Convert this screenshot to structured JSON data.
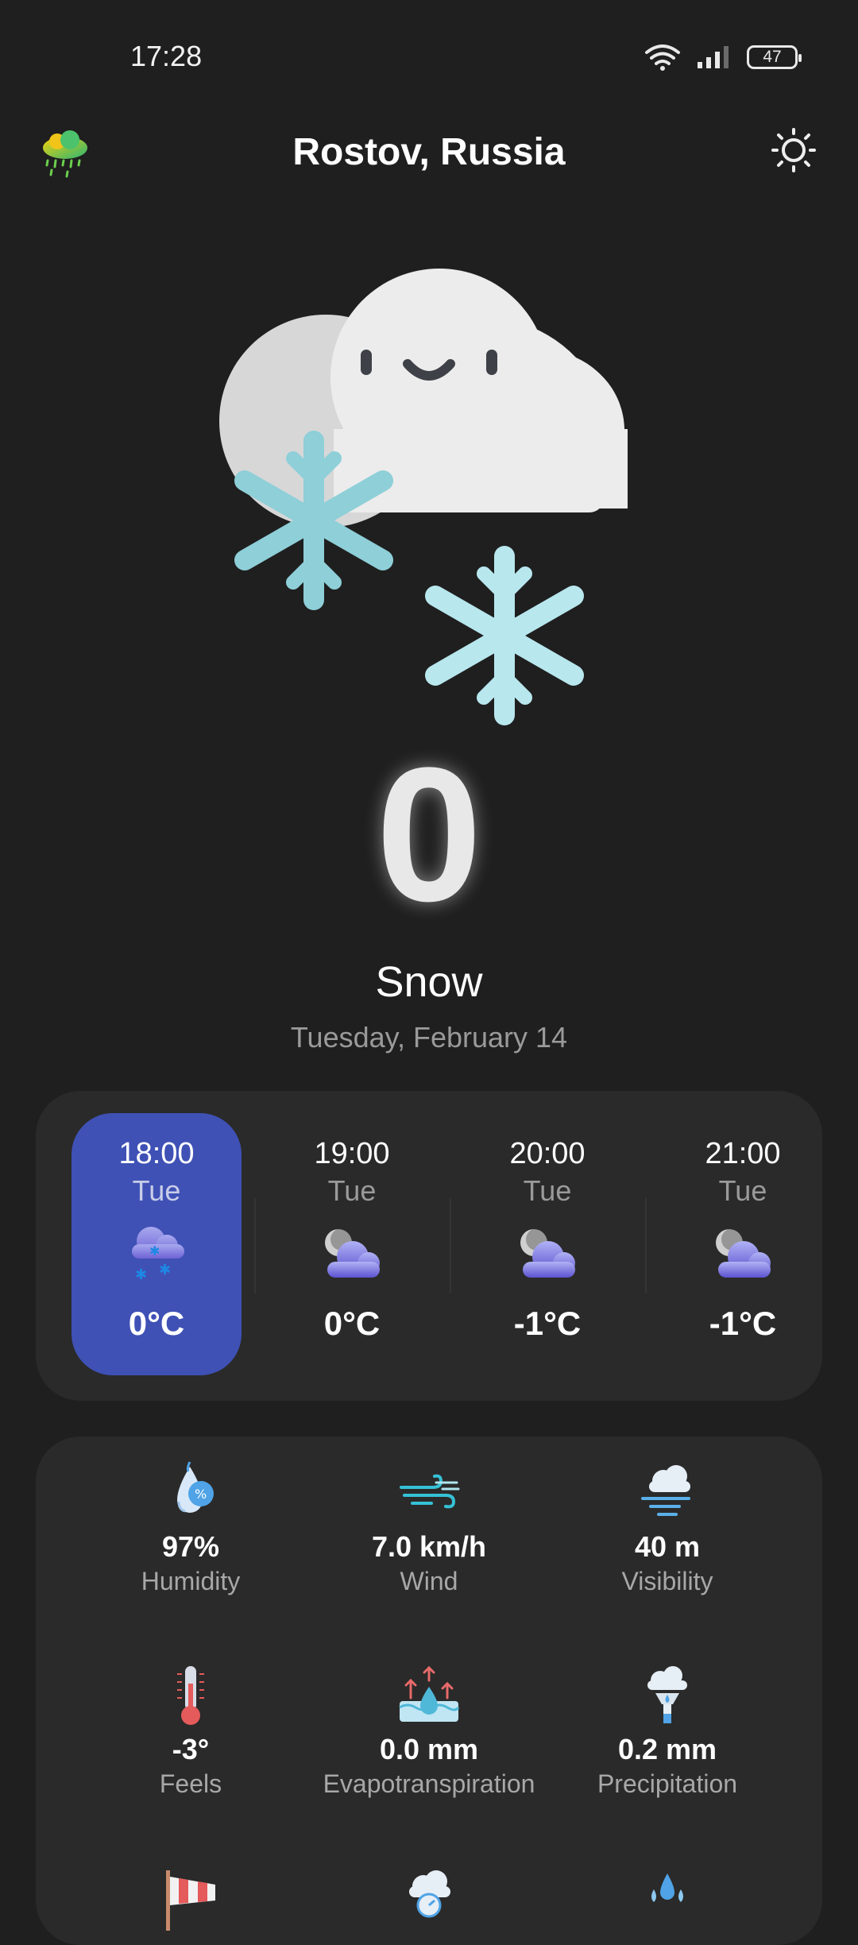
{
  "status_bar": {
    "time": "17:28",
    "battery": "47",
    "icons": [
      "wifi-icon",
      "signal-icon",
      "battery-icon"
    ]
  },
  "header": {
    "location": "Rostov, Russia",
    "app_icon": "rain-cloud-icon",
    "theme_icon": "sun-icon"
  },
  "current": {
    "icon": "snow-cloud-icon",
    "temperature": "0",
    "condition": "Snow",
    "date": "Tuesday, February 14"
  },
  "hourly": [
    {
      "time": "18:00",
      "day": "Tue",
      "temp": "0°C",
      "icon": "snow-icon",
      "selected": true
    },
    {
      "time": "19:00",
      "day": "Tue",
      "temp": "0°C",
      "icon": "night-cloud-icon",
      "selected": false
    },
    {
      "time": "20:00",
      "day": "Tue",
      "temp": "-1°C",
      "icon": "night-cloud-icon",
      "selected": false
    },
    {
      "time": "21:00",
      "day": "Tue",
      "temp": "-1°C",
      "icon": "night-cloud-icon",
      "selected": false
    }
  ],
  "details": [
    {
      "value": "97%",
      "label": "Humidity",
      "icon": "humidity-icon"
    },
    {
      "value": "7.0 km/h",
      "label": "Wind",
      "icon": "wind-icon"
    },
    {
      "value": "40 m",
      "label": "Visibility",
      "icon": "fog-icon"
    },
    {
      "value": "-3°",
      "label": "Feels",
      "icon": "thermometer-icon"
    },
    {
      "value": "0.0 mm",
      "label": "Evapotranspiration",
      "icon": "evaporation-icon"
    },
    {
      "value": "0.2 mm",
      "label": "Precipitation",
      "icon": "rain-gauge-icon"
    }
  ],
  "colors": {
    "background": "#1f1f1f",
    "card": "#2a2a2a",
    "accent": "#3f51b5"
  }
}
